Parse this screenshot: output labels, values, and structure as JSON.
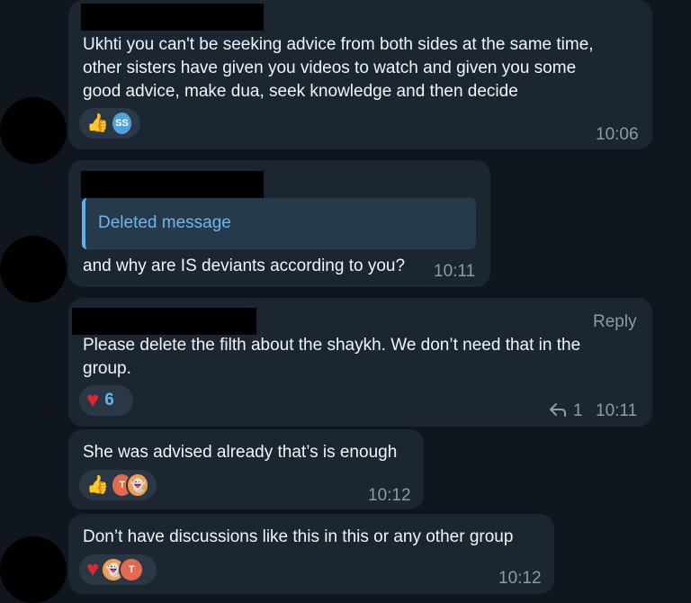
{
  "messages": [
    {
      "text_lines": [
        "Ukhti you can't be seeking advice from both sides at the same time,",
        "other sisters have given you videos to watch and given you some",
        "good advice, make dua, seek knowledge and then decide"
      ],
      "reactions": [
        "👍",
        "SS"
      ],
      "time": "10:06"
    },
    {
      "quote": "Deleted message",
      "text": "and why are IS deviants according to you?",
      "time": "10:11"
    },
    {
      "reply_label": "Reply",
      "text_lines": [
        "Please delete the filth about the shaykh. We don’t need that in the",
        "group."
      ],
      "reaction_emoji": "♥",
      "reaction_count": "6",
      "replies": "1",
      "time": "10:11"
    },
    {
      "text": "She was advised already that’s is enough",
      "reactions": [
        "👍",
        "T",
        "👻"
      ],
      "time": "10:12"
    },
    {
      "text": "Don’t have discussions like this in this or any other group",
      "reactions": [
        "♥",
        "👻",
        "T"
      ],
      "time": "10:12"
    }
  ],
  "colors": {
    "background": "#0f161e",
    "bubble": "#1c2630",
    "accent": "#5eb5f7",
    "heart": "#e0262f"
  }
}
